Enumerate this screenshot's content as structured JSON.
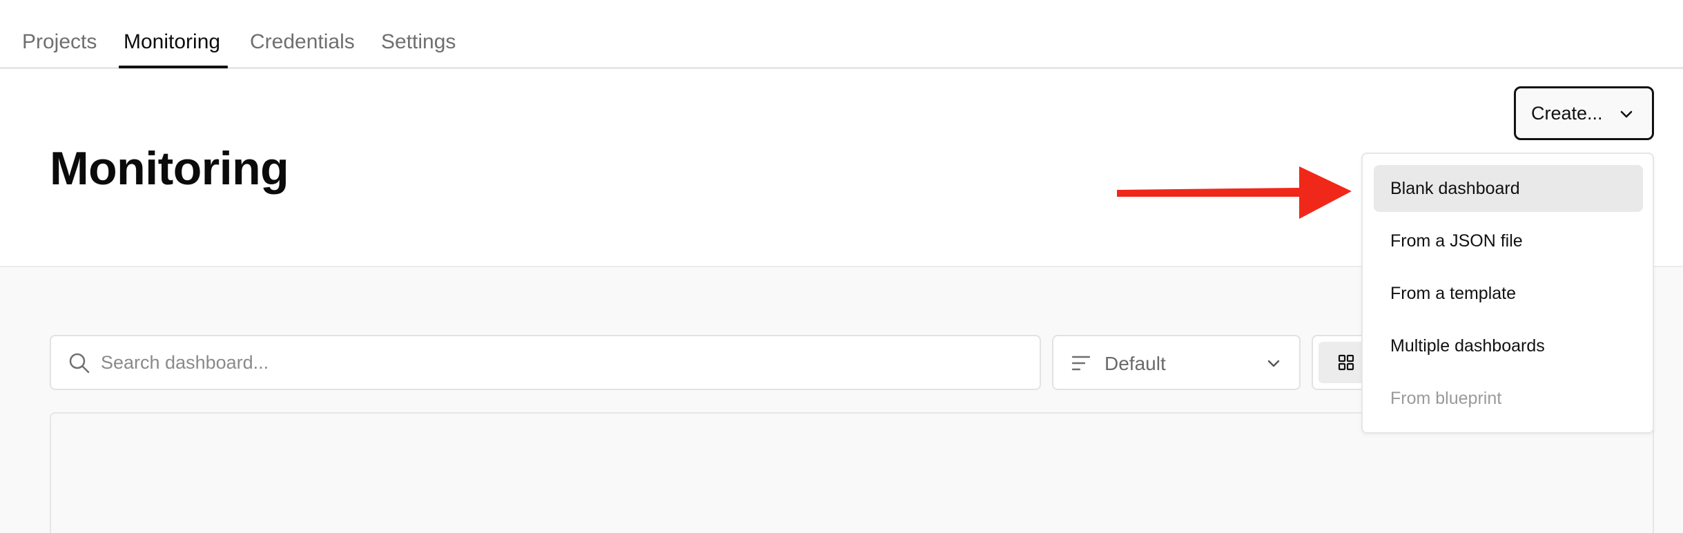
{
  "tabs": [
    {
      "label": "Projects",
      "active": false
    },
    {
      "label": "Monitoring",
      "active": true
    },
    {
      "label": "Credentials",
      "active": false
    },
    {
      "label": "Settings",
      "active": false
    }
  ],
  "page": {
    "title": "Monitoring"
  },
  "create_button": {
    "label": "Create...",
    "icon": "chevron-down-icon"
  },
  "search": {
    "placeholder": "Search dashboard...",
    "value": "",
    "icon": "search-icon"
  },
  "sort": {
    "selected": "Default",
    "icon": "sort-icon"
  },
  "view_toggle": {
    "selected_icon": "grid-view-icon"
  },
  "dropdown_menu": {
    "items": [
      {
        "label": "Blank dashboard",
        "highlighted": true,
        "disabled": false
      },
      {
        "label": "From a JSON file",
        "highlighted": false,
        "disabled": false
      },
      {
        "label": "From a template",
        "highlighted": false,
        "disabled": false
      },
      {
        "label": "Multiple dashboards",
        "highlighted": false,
        "disabled": false
      },
      {
        "label": "From blueprint",
        "highlighted": false,
        "disabled": true
      }
    ]
  },
  "annotation": {
    "arrow_color": "#f0281a",
    "icon": "arrow-right-icon"
  },
  "colors": {
    "accent": "#111111",
    "muted_text": "#6f6f6f",
    "background_gray": "#f9f9f9"
  }
}
